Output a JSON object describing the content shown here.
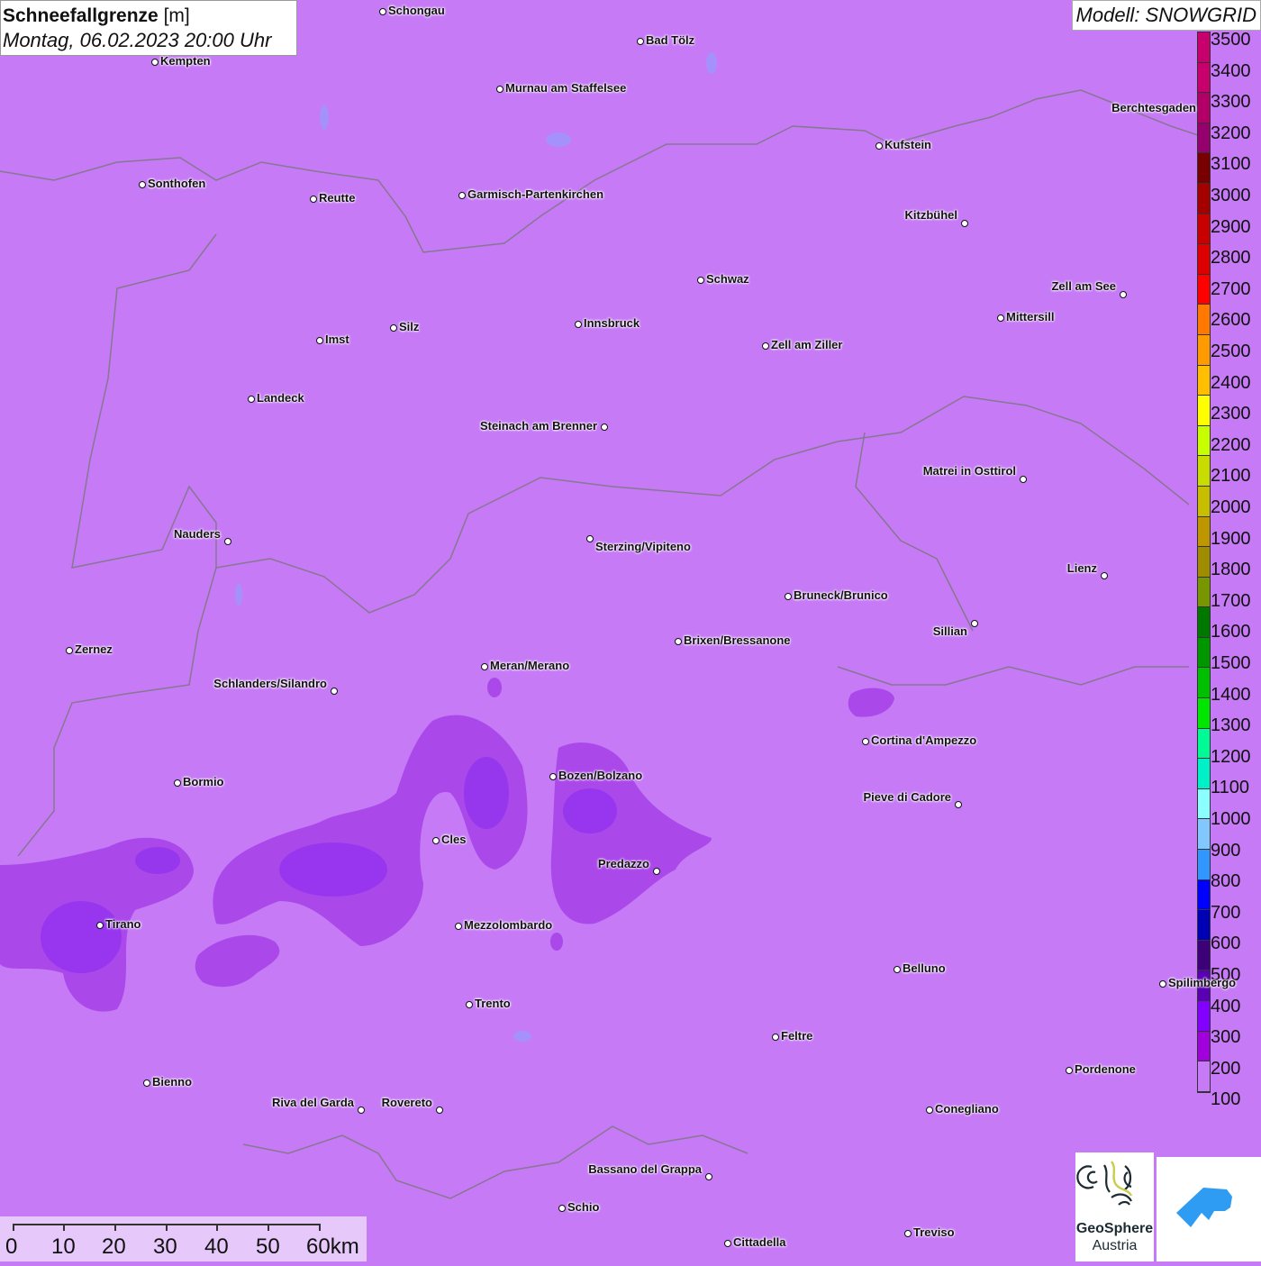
{
  "title": {
    "param": "Schneefallgrenze",
    "unit": "[m]",
    "datetime": "Montag, 06.02.2023 20:00 Uhr"
  },
  "model": "Modell: SNOWGRID",
  "legend": {
    "labels": [
      "3500",
      "3400",
      "3300",
      "3200",
      "3100",
      "3000",
      "2900",
      "2800",
      "2700",
      "2600",
      "2500",
      "2400",
      "2300",
      "2200",
      "2100",
      "2000",
      "1900",
      "1800",
      "1700",
      "1600",
      "1500",
      "1400",
      "1300",
      "1200",
      "1100",
      "1000",
      "900",
      "800",
      "700",
      "600",
      "500",
      "400",
      "300",
      "200",
      "100"
    ],
    "colors": [
      "#c8006e",
      "#c8006e",
      "#b20068",
      "#96006e",
      "#780000",
      "#a50000",
      "#c80000",
      "#dc0000",
      "#ff0000",
      "#ff7800",
      "#ff9b00",
      "#ffbe00",
      "#ffff00",
      "#c8ff00",
      "#c8dc00",
      "#c8be00",
      "#be9600",
      "#a08c00",
      "#789600",
      "#007800",
      "#009600",
      "#00be00",
      "#00e600",
      "#00fa96",
      "#00f0c8",
      "#8cffff",
      "#82c8ff",
      "#3296ff",
      "#0000ff",
      "#0000b4",
      "#3c0078",
      "#5a00b4",
      "#8200ff",
      "#a000dc",
      "#c67af6"
    ]
  },
  "cities": [
    "Schongau",
    "Bad Tölz",
    "Kempten",
    "Murnau am Staffelsee",
    "Berchtesgaden",
    "Kufstein",
    "Sonthofen",
    "Reutte",
    "Garmisch-Partenkirchen",
    "Kitzbühel",
    "Schwaz",
    "Zell am See",
    "Mittersill",
    "Innsbruck",
    "Silz",
    "Imst",
    "Zell am Ziller",
    "Landeck",
    "Steinach am Brenner",
    "Matrei in Osttirol",
    "Nauders",
    "Sterzing/Vipiteno",
    "Lienz",
    "Bruneck/Brunico",
    "Sillian",
    "Brixen/Bressanone",
    "Zernez",
    "Meran/Merano",
    "Schlanders/Silandro",
    "Cortina d'Ampezzo",
    "Bozen/Bolzano",
    "Bormio",
    "Pieve di Cadore",
    "Cles",
    "Predazzo",
    "Tirano",
    "Mezzolombardo",
    "Belluno",
    "Spilimbergo",
    "Trento",
    "Feltre",
    "Pordenone",
    "Bienno",
    "Riva del Garda",
    "Rovereto",
    "Conegliano",
    "Bassano del Grappa",
    "Schio",
    "Treviso",
    "Cittadella"
  ],
  "scale": {
    "ticks": [
      "0",
      "10",
      "20",
      "30",
      "40",
      "50",
      "60km"
    ]
  },
  "logos": {
    "geosphere_line1": "GeoSphere",
    "geosphere_line2": "Austria"
  }
}
